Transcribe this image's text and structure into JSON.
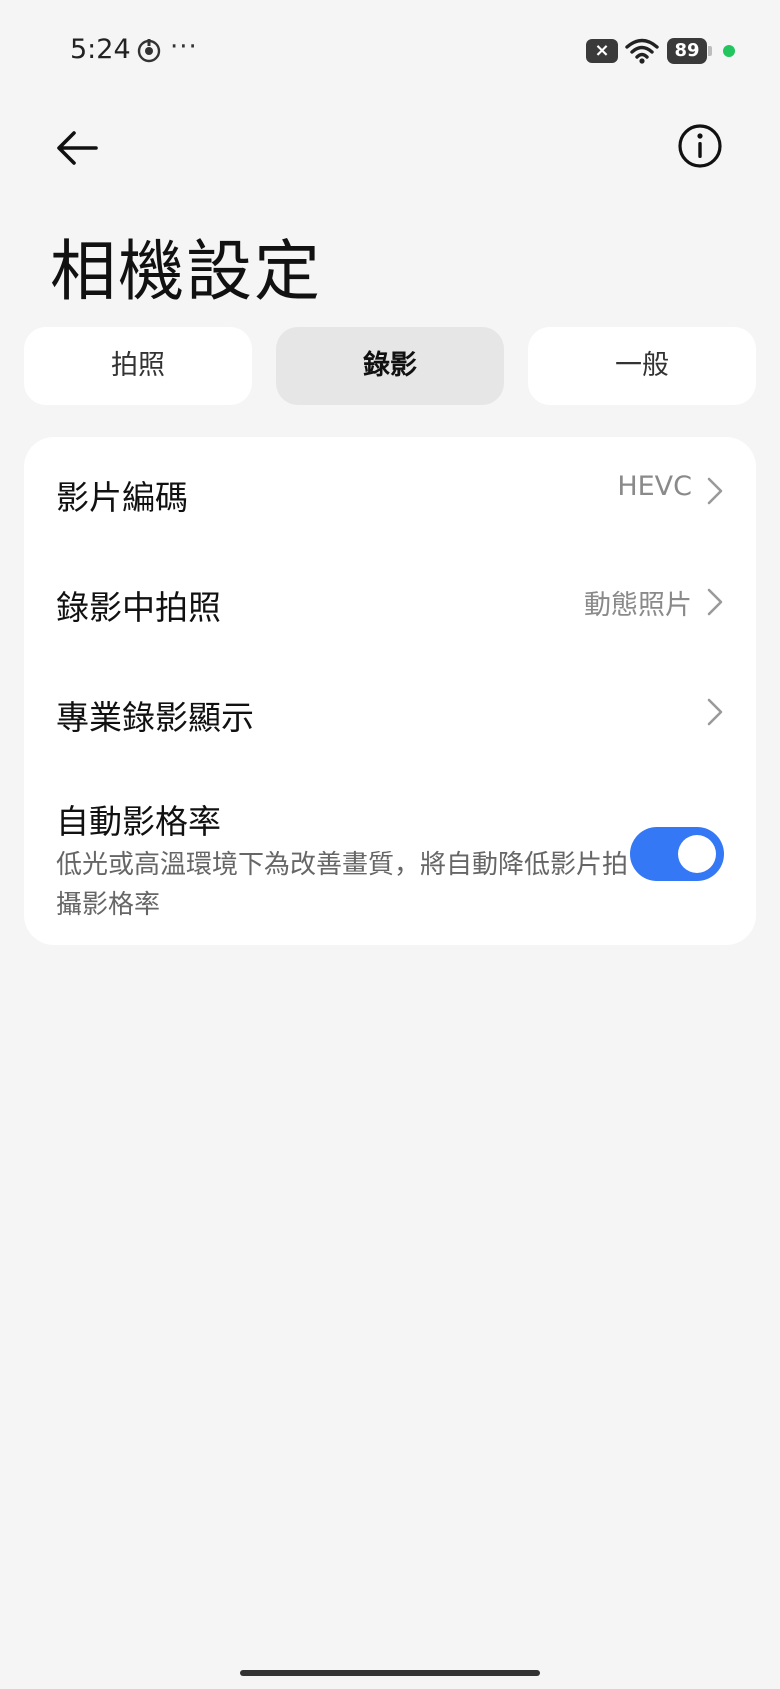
{
  "status_bar": {
    "time": "5:24",
    "dots": "···",
    "x_icon": "×",
    "battery": "89",
    "wifi_icon": "wifi-icon",
    "focus_icon": "focus-icon"
  },
  "header": {
    "title": "相機設定",
    "back_icon": "back-arrow-icon",
    "info_icon": "info-icon"
  },
  "tabs": [
    {
      "label": "拍照",
      "active": false
    },
    {
      "label": "錄影",
      "active": true
    },
    {
      "label": "一般",
      "active": false
    }
  ],
  "settings": [
    {
      "label": "影片編碼",
      "value": "HEVC"
    },
    {
      "label": "錄影中拍照",
      "value": "動態照片"
    },
    {
      "label": "專業錄影顯示",
      "value": ""
    },
    {
      "label": "自動影格率",
      "description": "低光或高溫環境下為改善畫質，將自動降低影片拍攝影格率",
      "toggle_on": true
    }
  ],
  "colors": {
    "accent": "#3478f6",
    "background": "#f5f5f5",
    "battery_dot": "#22c55e"
  }
}
